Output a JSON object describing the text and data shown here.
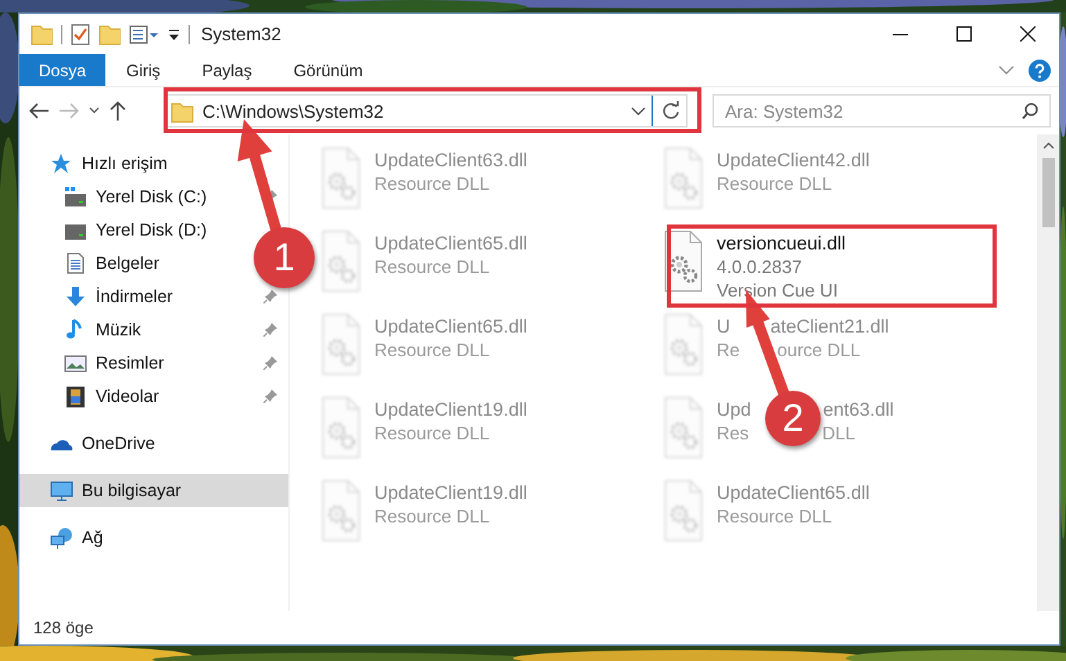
{
  "window": {
    "title": "System32"
  },
  "ribbon": {
    "tabs": [
      {
        "label": "Dosya",
        "kind": "file-menu"
      },
      {
        "label": "Giriş",
        "kind": "tab"
      },
      {
        "label": "Paylaş",
        "kind": "tab"
      },
      {
        "label": "Görünüm",
        "kind": "tab"
      }
    ]
  },
  "address": {
    "path": "C:\\Windows\\System32"
  },
  "search": {
    "placeholder": "Ara: System32"
  },
  "sidebar": {
    "items": [
      {
        "label": "Hızlı erişim",
        "kind": "quick-access",
        "pinned": false,
        "selected": false,
        "children": [
          {
            "label": "Yerel Disk (C:)",
            "kind": "system-drive",
            "pinned": true,
            "selected": false
          },
          {
            "label": "Yerel Disk (D:)",
            "kind": "drive",
            "pinned": false,
            "selected": false
          },
          {
            "label": "Belgeler",
            "kind": "documents",
            "pinned": false,
            "selected": false
          },
          {
            "label": "İndirmeler",
            "kind": "downloads",
            "pinned": true,
            "selected": false
          },
          {
            "label": "Müzik",
            "kind": "music",
            "pinned": true,
            "selected": false
          },
          {
            "label": "Resimler",
            "kind": "pictures",
            "pinned": true,
            "selected": false
          },
          {
            "label": "Videolar",
            "kind": "videos",
            "pinned": true,
            "selected": false
          }
        ]
      },
      {
        "label": "OneDrive",
        "kind": "cloud",
        "pinned": false,
        "selected": false
      },
      {
        "label": "Bu bilgisayar",
        "kind": "computer",
        "pinned": false,
        "selected": true
      },
      {
        "label": "Ağ",
        "kind": "network",
        "pinned": false,
        "selected": false
      }
    ]
  },
  "files": [
    {
      "name": "UpdateClient63.dll",
      "details": [
        "Resource DLL"
      ],
      "blurred": true
    },
    {
      "name": "UpdateClient42.dll",
      "details": [
        "Resource DLL"
      ],
      "blurred": true
    },
    {
      "name": "UpdateClient65.dll",
      "details": [
        "Resource DLL"
      ],
      "blurred": true
    },
    {
      "name": "versioncueui.dll",
      "details": [
        "4.0.0.2837",
        "Version Cue UI"
      ],
      "blurred": false
    },
    {
      "name": "UpdateClient65.dll",
      "details": [
        "Resource DLL"
      ],
      "blurred": true
    },
    {
      "name": [
        "U",
        "ateClient21.dll"
      ],
      "details": [
        [
          "Re",
          "ource DLL"
        ]
      ],
      "blurred": true
    },
    {
      "name": "UpdateClient19.dll",
      "details": [
        "Resource DLL"
      ],
      "blurred": true
    },
    {
      "name": [
        "Upd",
        "ent63.dll"
      ],
      "details": [
        [
          "Res",
          "DLL"
        ]
      ],
      "blurred": true
    },
    {
      "name": "UpdateClient19.dll",
      "details": [
        "Resource DLL"
      ],
      "blurred": true
    },
    {
      "name": "UpdateClient65.dll",
      "details": [
        "Resource DLL"
      ],
      "blurred": true
    }
  ],
  "status_bar": {
    "count": "128 öge"
  },
  "callouts": [
    {
      "label": "1"
    },
    {
      "label": "2"
    }
  ]
}
